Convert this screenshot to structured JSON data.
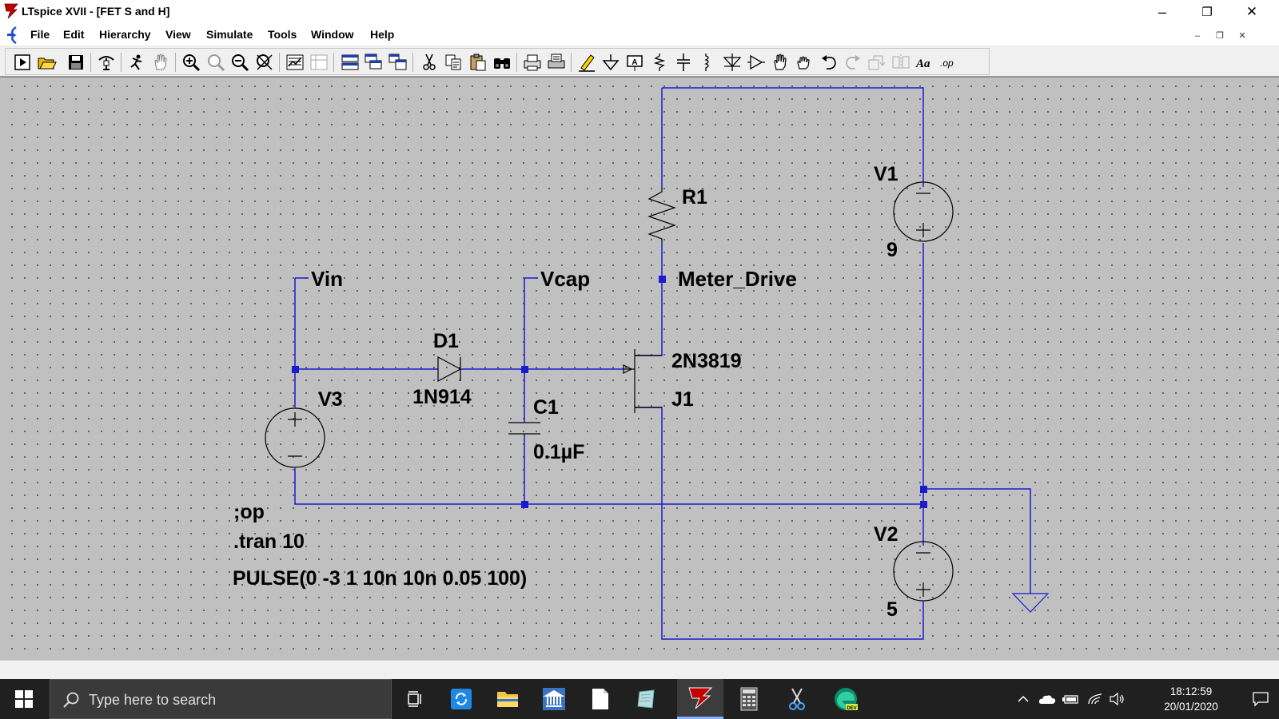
{
  "window": {
    "title": "LTspice XVII - [FET S and H]",
    "controls": {
      "minimize": "–",
      "maximize": "❐",
      "close": "✕"
    }
  },
  "menubar": {
    "items": [
      "File",
      "Edit",
      "Hierarchy",
      "View",
      "Simulate",
      "Tools",
      "Window",
      "Help"
    ],
    "mdi_controls": {
      "minimize": "–",
      "restore": "❐",
      "close": "✕"
    }
  },
  "toolbar": {
    "buttons": [
      "run-icon",
      "open-icon",
      "save-icon",
      "control-panel-icon",
      "halt-icon",
      "pan-icon",
      "zoom-in-icon",
      "zoom-area-icon",
      "zoom-out-icon",
      "zoom-fit-icon",
      "autorange-icon",
      "grid-icon",
      "tile-horizontal-icon",
      "cascade-icon",
      "tile-vertical-icon",
      "cut-icon",
      "copy-icon",
      "paste-icon",
      "find-icon",
      "print-preview-icon",
      "print-icon",
      "wire-icon",
      "ground-icon",
      "label-net-icon",
      "resistor-icon",
      "capacitor-icon",
      "inductor-icon",
      "diode-icon",
      "component-icon",
      "move-icon",
      "drag-icon",
      "undo-icon",
      "redo-icon",
      "rotate-icon",
      "mirror-icon",
      "text-icon",
      "spice-directive-icon"
    ],
    "text_button_aa": "Aa",
    "text_button_op": ".op"
  },
  "schematic": {
    "wire_color": "#1b1bd0",
    "junction_color": "#1b1bd0",
    "labels": {
      "vin": "Vin",
      "vcap": "Vcap",
      "meter_drive": "Meter_Drive",
      "r1": "R1",
      "v1": "V1",
      "v1_value": "9",
      "d1": "D1",
      "d1_model": "1N914",
      "v3": "V3",
      "c1": "C1",
      "c1_value": "0.1µF",
      "j1_model": "2N3819",
      "j1": "J1",
      "v2": "V2",
      "v2_value": "5",
      "directive_op": ";op",
      "directive_tran": ".tran 10",
      "v3_source": "PULSE(0 -3 1 10n 10n 0.05 100)"
    }
  },
  "taskbar": {
    "search_placeholder": "Type here to search",
    "pinned": [
      "task-view-icon",
      "sync-app-icon",
      "file-explorer-icon",
      "bank-app-icon",
      "notepad-icon",
      "paper-app-icon",
      "ltspice-icon",
      "calculator-icon",
      "snipping-tool-icon",
      "edge-dev-icon"
    ],
    "tray": [
      "show-hidden-icons-icon",
      "onedrive-icon",
      "battery-icon",
      "wifi-icon",
      "volume-icon"
    ],
    "time": "18:12:59",
    "date": "20/01/2020"
  }
}
